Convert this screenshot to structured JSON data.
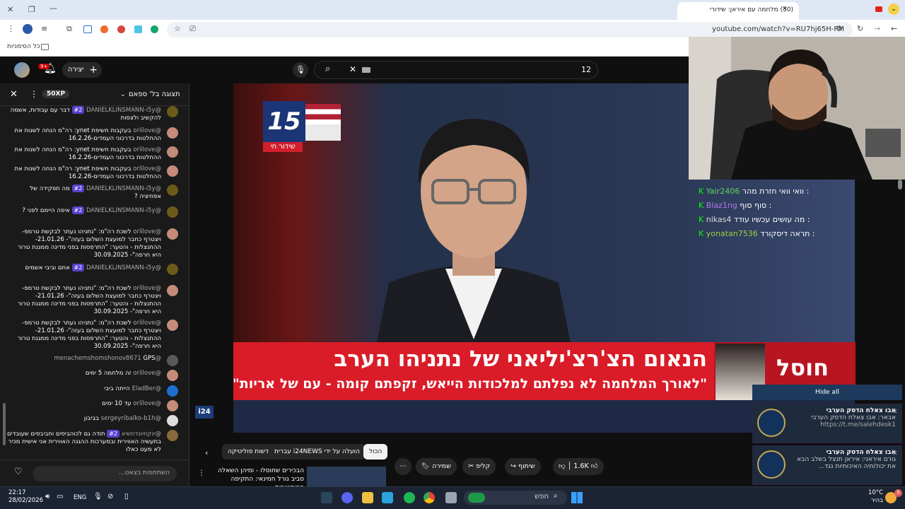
{
  "browser": {
    "tab_title": "(30) מלחמה עם איראן: שידורי",
    "url": "youtube.com/watch?v=RU7hj65H-PM",
    "bookmarks_label": "כל הסימניות"
  },
  "youtube": {
    "search_query": "12",
    "create_label": "יצירה",
    "notification_count": "9+"
  },
  "chat": {
    "header": "תצוגה בל' ספאם",
    "xp_badge": "50XP",
    "input_placeholder": "השתתפות בצאט...",
    "messages": [
      {
        "user": "@DANIELKLINSMANN-i5y",
        "badge": "#2",
        "text": "דבר עם עבודות, אשמה להקשיב ולצפות"
      },
      {
        "user": "@orlilove",
        "text": "בעקבות חשיפת ynet: רה\"מ הנחה לשנות את ההחלטות בדרכוני העמדים-16.2.26"
      },
      {
        "user": "@orlilove",
        "text": "בעקבות חשיפת ynet: רה\"מ הנחה לשנות את ההחלטות בדרכוני העמדים-16.2.26"
      },
      {
        "user": "@orlilove",
        "text": "בעקבות חשיפת ynet: רה\"מ הנחה לשנות את ההחלטות בדרכוני העמדים-16.2.26"
      },
      {
        "user": "@DANIELKLINSMANN-i5y",
        "badge": "#2",
        "text": "מה תפקידה של אפוזיציה ?"
      },
      {
        "user": "@DANIELKLINSMANN-i5y",
        "badge": "#2",
        "text": "איפה היימם לפני ?"
      },
      {
        "user": "@orlilove",
        "text": "לשכת רה\"מ: \"נתניהו נעתר לבקשת טרמפ- ויצטרף כחבר למועצת השלום בעזה\"- 21.01.26- ההתנצלות - והטער: \"התרפסות בפני מדינה ממגנת טרור היא חרפה\"- 30.09.2025"
      },
      {
        "user": "@DANIELKLINSMANN-i5y",
        "badge": "#2",
        "text": "אתם וביבי אשמים"
      },
      {
        "user": "@orlilove",
        "text": "לשכת רה\"מ: \"נתניהו נעתר לבקשת טרמפ- ויצטרף כחבר למועצת השלום בעזה\"- 21.01.26- ההתנצלות - והטער: \"התרפסות בפני מדינה ממגנת טרור היא חרפה\"- 30.09.2025"
      },
      {
        "user": "@orlilove",
        "text": "לשכת רה\"מ: \"נתניהו נעתר לבקשת טרמפ- ויצטרף כחבר למועצת השלום בעזה\"- 21.01.26- ההתנצלות - והטער: \"התרפסות בפני מדינה ממגנת טרור היא חרפה\"- 30.09.2025"
      },
      {
        "user": "@menachemshomshonov8671",
        "text": "GPS"
      },
      {
        "user": "@orlilove",
        "text": "זה מלחמה 5 ימים"
      },
      {
        "user": "@EladBer",
        "text": "הייתה ביבי"
      },
      {
        "user": "@orlilove",
        "text": "עד 10 ימים"
      },
      {
        "user": "@sergeyribalko-b1h",
        "text": "בביבון"
      },
      {
        "user": "@ינקוזיונדוזשיא",
        "badge": "#2",
        "text": "תודה גם לכוהביסים וחביבסים שעובדים בתעשיה האווירית ובמערכות ההגנה האווירית אני אישית מכיר לא מעט כאלו"
      }
    ]
  },
  "video": {
    "channel_logo_text": "15",
    "live_label": "שידור חי",
    "headline": "הנאום הצ'רצ'יליאני של נתניהו הערב",
    "subheadline": "\"לאורך המלחמה לא נפלתם למלכודות הייאש, זקפתם קומה - עם של אריות\"",
    "side_word": "חוסל",
    "corner_logo": "i24"
  },
  "twitch_chat": [
    {
      "user": "Yair2406",
      "text": "וואי וואי חזרת מהר :"
    },
    {
      "user": "Blaz1ng",
      "text": "סוף סוף :"
    },
    {
      "user": "nikas4",
      "text": "מה עושים עכשיו עודד :"
    },
    {
      "user": "yonatan7536",
      "text": "תראה דיסקורד :"
    }
  ],
  "notifications": {
    "hide_all": "Hide all",
    "items": [
      {
        "title": "אבו צאלח הדסק הערבי",
        "body": "אבאר: אבו צאלח הדסק הערבי",
        "link": "https://t.me/salehdesk1"
      },
      {
        "title": "אבו צאלח הדסק הערבי",
        "body": "גורם איראני: איראן תנצל בשלב הבא את יכולותיה האיכותיות נגד..."
      }
    ]
  },
  "below_video": {
    "chips": [
      "הכול",
      "הועלה על ידי i24NEWS עברית",
      "חדשות פוליטיקה"
    ],
    "likes": "1.6K",
    "share": "שיתוף",
    "clip": "קליפ",
    "save": "שמירה",
    "related_title": "הבכירים שחוסלו - ומיהן השאלה סביב גורל חמינאי: התקיפה ההיסטורית ..."
  },
  "taskbar": {
    "time": "22:17",
    "date": "28/02/2026",
    "lang": "ENG",
    "search": "חפש",
    "weather_temp": "10°C",
    "weather_desc": "בהיר"
  },
  "colors": {
    "banner_red": "#d91c28",
    "chat_bg": "#1a1a1a",
    "accent_purple": "#5a3fcf"
  }
}
